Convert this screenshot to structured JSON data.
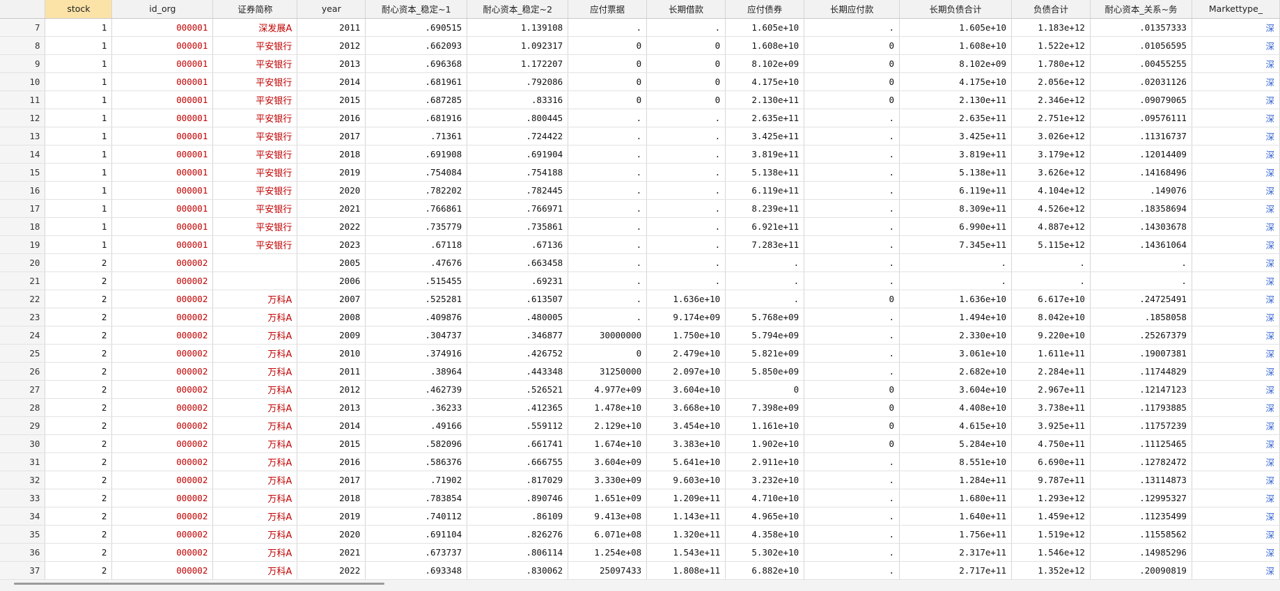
{
  "table": {
    "columns": [
      {
        "key": "rownum",
        "label": ""
      },
      {
        "key": "stock",
        "label": "stock"
      },
      {
        "key": "id_org",
        "label": "id_org"
      },
      {
        "key": "name",
        "label": "证券简称"
      },
      {
        "key": "year",
        "label": "year"
      },
      {
        "key": "nc1",
        "label": "耐心资本_稳定~1"
      },
      {
        "key": "nc2",
        "label": "耐心资本_稳定~2"
      },
      {
        "key": "notes",
        "label": "应付票据"
      },
      {
        "key": "ltloan",
        "label": "长期借款"
      },
      {
        "key": "bonds",
        "label": "应付债券"
      },
      {
        "key": "ltpay",
        "label": "长期应付款"
      },
      {
        "key": "ltdebt",
        "label": "长期负债合计"
      },
      {
        "key": "debt",
        "label": "负债合计"
      },
      {
        "key": "ncrel",
        "label": "耐心资本_关系~务"
      },
      {
        "key": "mkt",
        "label": "Markettype_"
      }
    ],
    "selected_column": "stock",
    "rows": [
      [
        "7",
        "1",
        "000001",
        "深发展A",
        "2011",
        ".690515",
        "1.139108",
        ".",
        ".",
        "1.605e+10",
        ".",
        "1.605e+10",
        "1.183e+12",
        ".01357333",
        "深"
      ],
      [
        "8",
        "1",
        "000001",
        "平安银行",
        "2012",
        ".662093",
        "1.092317",
        "0",
        "0",
        "1.608e+10",
        "0",
        "1.608e+10",
        "1.522e+12",
        ".01056595",
        "深"
      ],
      [
        "9",
        "1",
        "000001",
        "平安银行",
        "2013",
        ".696368",
        "1.172207",
        "0",
        "0",
        "8.102e+09",
        "0",
        "8.102e+09",
        "1.780e+12",
        ".00455255",
        "深"
      ],
      [
        "10",
        "1",
        "000001",
        "平安银行",
        "2014",
        ".681961",
        ".792086",
        "0",
        "0",
        "4.175e+10",
        "0",
        "4.175e+10",
        "2.056e+12",
        ".02031126",
        "深"
      ],
      [
        "11",
        "1",
        "000001",
        "平安银行",
        "2015",
        ".687285",
        ".83316",
        "0",
        "0",
        "2.130e+11",
        "0",
        "2.130e+11",
        "2.346e+12",
        ".09079065",
        "深"
      ],
      [
        "12",
        "1",
        "000001",
        "平安银行",
        "2016",
        ".681916",
        ".800445",
        ".",
        ".",
        "2.635e+11",
        ".",
        "2.635e+11",
        "2.751e+12",
        ".09576111",
        "深"
      ],
      [
        "13",
        "1",
        "000001",
        "平安银行",
        "2017",
        ".71361",
        ".724422",
        ".",
        ".",
        "3.425e+11",
        ".",
        "3.425e+11",
        "3.026e+12",
        ".11316737",
        "深"
      ],
      [
        "14",
        "1",
        "000001",
        "平安银行",
        "2018",
        ".691908",
        ".691904",
        ".",
        ".",
        "3.819e+11",
        ".",
        "3.819e+11",
        "3.179e+12",
        ".12014409",
        "深"
      ],
      [
        "15",
        "1",
        "000001",
        "平安银行",
        "2019",
        ".754084",
        ".754188",
        ".",
        ".",
        "5.138e+11",
        ".",
        "5.138e+11",
        "3.626e+12",
        ".14168496",
        "深"
      ],
      [
        "16",
        "1",
        "000001",
        "平安银行",
        "2020",
        ".782202",
        ".782445",
        ".",
        ".",
        "6.119e+11",
        ".",
        "6.119e+11",
        "4.104e+12",
        ".149076",
        "深"
      ],
      [
        "17",
        "1",
        "000001",
        "平安银行",
        "2021",
        ".766861",
        ".766971",
        ".",
        ".",
        "8.239e+11",
        ".",
        "8.309e+11",
        "4.526e+12",
        ".18358694",
        "深"
      ],
      [
        "18",
        "1",
        "000001",
        "平安银行",
        "2022",
        ".735779",
        ".735861",
        ".",
        ".",
        "6.921e+11",
        ".",
        "6.990e+11",
        "4.887e+12",
        ".14303678",
        "深"
      ],
      [
        "19",
        "1",
        "000001",
        "平安银行",
        "2023",
        ".67118",
        ".67136",
        ".",
        ".",
        "7.283e+11",
        ".",
        "7.345e+11",
        "5.115e+12",
        ".14361064",
        "深"
      ],
      [
        "20",
        "2",
        "000002",
        "",
        "2005",
        ".47676",
        ".663458",
        ".",
        ".",
        ".",
        ".",
        ".",
        ".",
        ".",
        "深"
      ],
      [
        "21",
        "2",
        "000002",
        "",
        "2006",
        ".515455",
        ".69231",
        ".",
        ".",
        ".",
        ".",
        ".",
        ".",
        ".",
        "深"
      ],
      [
        "22",
        "2",
        "000002",
        "万科A",
        "2007",
        ".525281",
        ".613507",
        ".",
        "1.636e+10",
        ".",
        "0",
        "1.636e+10",
        "6.617e+10",
        ".24725491",
        "深"
      ],
      [
        "23",
        "2",
        "000002",
        "万科A",
        "2008",
        ".409876",
        ".480005",
        ".",
        "9.174e+09",
        "5.768e+09",
        ".",
        "1.494e+10",
        "8.042e+10",
        ".1858058",
        "深"
      ],
      [
        "24",
        "2",
        "000002",
        "万科A",
        "2009",
        ".304737",
        ".346877",
        "30000000",
        "1.750e+10",
        "5.794e+09",
        ".",
        "2.330e+10",
        "9.220e+10",
        ".25267379",
        "深"
      ],
      [
        "25",
        "2",
        "000002",
        "万科A",
        "2010",
        ".374916",
        ".426752",
        "0",
        "2.479e+10",
        "5.821e+09",
        ".",
        "3.061e+10",
        "1.611e+11",
        ".19007381",
        "深"
      ],
      [
        "26",
        "2",
        "000002",
        "万科A",
        "2011",
        ".38964",
        ".443348",
        "31250000",
        "2.097e+10",
        "5.850e+09",
        ".",
        "2.682e+10",
        "2.284e+11",
        ".11744829",
        "深"
      ],
      [
        "27",
        "2",
        "000002",
        "万科A",
        "2012",
        ".462739",
        ".526521",
        "4.977e+09",
        "3.604e+10",
        "0",
        "0",
        "3.604e+10",
        "2.967e+11",
        ".12147123",
        "深"
      ],
      [
        "28",
        "2",
        "000002",
        "万科A",
        "2013",
        ".36233",
        ".412365",
        "1.478e+10",
        "3.668e+10",
        "7.398e+09",
        "0",
        "4.408e+10",
        "3.738e+11",
        ".11793885",
        "深"
      ],
      [
        "29",
        "2",
        "000002",
        "万科A",
        "2014",
        ".49166",
        ".559112",
        "2.129e+10",
        "3.454e+10",
        "1.161e+10",
        "0",
        "4.615e+10",
        "3.925e+11",
        ".11757239",
        "深"
      ],
      [
        "30",
        "2",
        "000002",
        "万科A",
        "2015",
        ".582096",
        ".661741",
        "1.674e+10",
        "3.383e+10",
        "1.902e+10",
        "0",
        "5.284e+10",
        "4.750e+11",
        ".11125465",
        "深"
      ],
      [
        "31",
        "2",
        "000002",
        "万科A",
        "2016",
        ".586376",
        ".666755",
        "3.604e+09",
        "5.641e+10",
        "2.911e+10",
        ".",
        "8.551e+10",
        "6.690e+11",
        ".12782472",
        "深"
      ],
      [
        "32",
        "2",
        "000002",
        "万科A",
        "2017",
        ".71902",
        ".817029",
        "3.330e+09",
        "9.603e+10",
        "3.232e+10",
        ".",
        "1.284e+11",
        "9.787e+11",
        ".13114873",
        "深"
      ],
      [
        "33",
        "2",
        "000002",
        "万科A",
        "2018",
        ".783854",
        ".890746",
        "1.651e+09",
        "1.209e+11",
        "4.710e+10",
        ".",
        "1.680e+11",
        "1.293e+12",
        ".12995327",
        "深"
      ],
      [
        "34",
        "2",
        "000002",
        "万科A",
        "2019",
        ".740112",
        ".86109",
        "9.413e+08",
        "1.143e+11",
        "4.965e+10",
        ".",
        "1.640e+11",
        "1.459e+12",
        ".11235499",
        "深"
      ],
      [
        "35",
        "2",
        "000002",
        "万科A",
        "2020",
        ".691104",
        ".826276",
        "6.071e+08",
        "1.320e+11",
        "4.358e+10",
        ".",
        "1.756e+11",
        "1.519e+12",
        ".11558562",
        "深"
      ],
      [
        "36",
        "2",
        "000002",
        "万科A",
        "2021",
        ".673737",
        ".806114",
        "1.254e+08",
        "1.543e+11",
        "5.302e+10",
        ".",
        "2.317e+11",
        "1.546e+12",
        ".14985296",
        "深"
      ],
      [
        "37",
        "2",
        "000002",
        "万科A",
        "2022",
        ".693348",
        ".830062",
        "25097433",
        "1.808e+11",
        "6.882e+10",
        ".",
        "2.717e+11",
        "1.352e+12",
        ".20090819",
        "深"
      ]
    ]
  },
  "colors": {
    "header_bg": "#f2f2f2",
    "selected_header_bg": "#fbe3a8",
    "string_text": "#c00000",
    "number_text": "#111111",
    "label_text": "#2f5fd0",
    "rownum_bg": "#f5f5f5"
  }
}
